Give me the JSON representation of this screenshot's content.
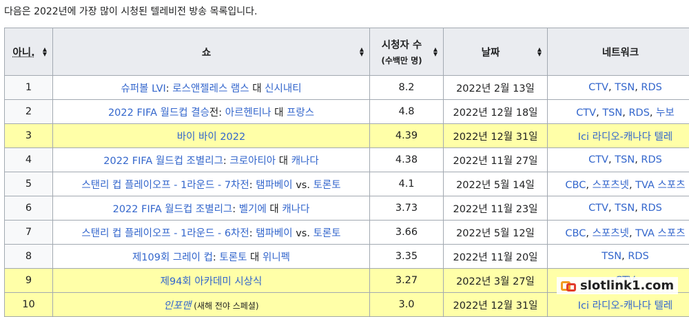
{
  "intro": "다음은 2022년에 가장 많이 시청된 텔레비전 방송 목록입니다.",
  "headers": {
    "no": "아니.",
    "show": "쇼",
    "viewers": "시청자 수",
    "viewers_unit": "(수백만 명)",
    "date": "날짜",
    "network": "네트워크"
  },
  "rows": [
    {
      "no": "1",
      "show": [
        {
          "t": "슈퍼볼 LVI",
          "l": true
        },
        {
          "t": ": ",
          "l": false
        },
        {
          "t": "로스앤젤레스 램스",
          "l": true
        },
        {
          "t": " 대 ",
          "l": false
        },
        {
          "t": "신시내티",
          "l": true
        }
      ],
      "viewers": "8.2",
      "date": "2022년 2월 13일",
      "network": [
        {
          "t": "CTV",
          "l": true
        },
        {
          "t": ", ",
          "l": false
        },
        {
          "t": "TSN",
          "l": true
        },
        {
          "t": ", ",
          "l": false
        },
        {
          "t": "RDS",
          "l": true
        }
      ]
    },
    {
      "no": "2",
      "show": [
        {
          "t": "2022 FIFA 월드컵 결승",
          "l": true
        },
        {
          "t": "전: ",
          "l": false
        },
        {
          "t": "아르헨티나",
          "l": true
        },
        {
          "t": " 대 ",
          "l": false
        },
        {
          "t": "프랑스",
          "l": true
        }
      ],
      "viewers": "4.8",
      "date": "2022년 12월 18일",
      "network": [
        {
          "t": "CTV",
          "l": true
        },
        {
          "t": ", ",
          "l": false
        },
        {
          "t": "TSN",
          "l": true
        },
        {
          "t": ", ",
          "l": false
        },
        {
          "t": "RDS",
          "l": true
        },
        {
          "t": ", ",
          "l": false
        },
        {
          "t": "누보",
          "l": true
        }
      ]
    },
    {
      "no": "3",
      "highlight": true,
      "show": [
        {
          "t": "바이 바이 2022",
          "l": true
        }
      ],
      "viewers": "4.39",
      "date": "2022년 12월 31일",
      "network": [
        {
          "t": "Ici 라디오-캐나다 텔레",
          "l": true
        }
      ]
    },
    {
      "no": "4",
      "show": [
        {
          "t": "2022 FIFA 월드컵 조별리그",
          "l": true
        },
        {
          "t": ": ",
          "l": false
        },
        {
          "t": "크로아티아",
          "l": true
        },
        {
          "t": " 대 ",
          "l": false
        },
        {
          "t": "캐나다",
          "l": true
        }
      ],
      "viewers": "4.38",
      "date": "2022년 11월 27일",
      "network": [
        {
          "t": "CTV",
          "l": true
        },
        {
          "t": ", ",
          "l": false
        },
        {
          "t": "TSN",
          "l": true
        },
        {
          "t": ", ",
          "l": false
        },
        {
          "t": "RDS",
          "l": true
        }
      ]
    },
    {
      "no": "5",
      "show": [
        {
          "t": "스탠리 컵 플레이오프 - 1라운드 - 7차전",
          "l": true
        },
        {
          "t": ": ",
          "l": false
        },
        {
          "t": "탬파베이",
          "l": true
        },
        {
          "t": " vs. ",
          "l": false
        },
        {
          "t": "토론토",
          "l": true
        }
      ],
      "viewers": "4.1",
      "date": "2022년 5월 14일",
      "network": [
        {
          "t": "CBC",
          "l": true
        },
        {
          "t": ", ",
          "l": false
        },
        {
          "t": "스포츠넷",
          "l": true
        },
        {
          "t": ", ",
          "l": false
        },
        {
          "t": "TVA 스포츠",
          "l": true
        }
      ]
    },
    {
      "no": "6",
      "show": [
        {
          "t": "2022 FIFA 월드컵 조별리그",
          "l": true
        },
        {
          "t": ": ",
          "l": false
        },
        {
          "t": "벨기에",
          "l": true
        },
        {
          "t": " 대 ",
          "l": false
        },
        {
          "t": "캐나다",
          "l": true
        }
      ],
      "viewers": "3.73",
      "date": "2022년 11월 23일",
      "network": [
        {
          "t": "CTV",
          "l": true
        },
        {
          "t": ", ",
          "l": false
        },
        {
          "t": "TSN",
          "l": true
        },
        {
          "t": ", ",
          "l": false
        },
        {
          "t": "RDS",
          "l": true
        }
      ]
    },
    {
      "no": "7",
      "show": [
        {
          "t": "스탠리 컵 플레이오프 - 1라운드 - 6차전",
          "l": true
        },
        {
          "t": ": ",
          "l": false
        },
        {
          "t": "탬파베이",
          "l": true
        },
        {
          "t": " vs. ",
          "l": false
        },
        {
          "t": "토론토",
          "l": true
        }
      ],
      "viewers": "3.66",
      "date": "2022년 5월 12일",
      "network": [
        {
          "t": "CBC",
          "l": true
        },
        {
          "t": ", ",
          "l": false
        },
        {
          "t": "스포츠넷",
          "l": true
        },
        {
          "t": ", ",
          "l": false
        },
        {
          "t": "TVA 스포츠",
          "l": true
        }
      ]
    },
    {
      "no": "8",
      "show": [
        {
          "t": "제109회 그레이 컵",
          "l": true
        },
        {
          "t": ": ",
          "l": false
        },
        {
          "t": "토론토",
          "l": true
        },
        {
          "t": " 대 ",
          "l": false
        },
        {
          "t": "위니펙",
          "l": true
        }
      ],
      "viewers": "3.35",
      "date": "2022년 11월 20일",
      "network": [
        {
          "t": "TSN",
          "l": true
        },
        {
          "t": ", ",
          "l": false
        },
        {
          "t": "RDS",
          "l": true
        }
      ]
    },
    {
      "no": "9",
      "highlight": true,
      "show": [
        {
          "t": "제94회 아카데미 시상식",
          "l": true
        }
      ],
      "viewers": "3.27",
      "date": "2022년 3월 27일",
      "network": [
        {
          "t": "CTV",
          "l": true
        }
      ]
    },
    {
      "no": "10",
      "highlight": true,
      "show": [
        {
          "t": "인포맨",
          "l": true,
          "i": true
        },
        {
          "t": " (새해 전야 스페셜)",
          "l": false,
          "s": true
        }
      ],
      "viewers": "3.0",
      "date": "2022년 12월 31일",
      "network": [
        {
          "t": "Ici 라디오-캐나다 텔레",
          "l": true
        }
      ]
    }
  ],
  "watermark": "slotlink1.com"
}
